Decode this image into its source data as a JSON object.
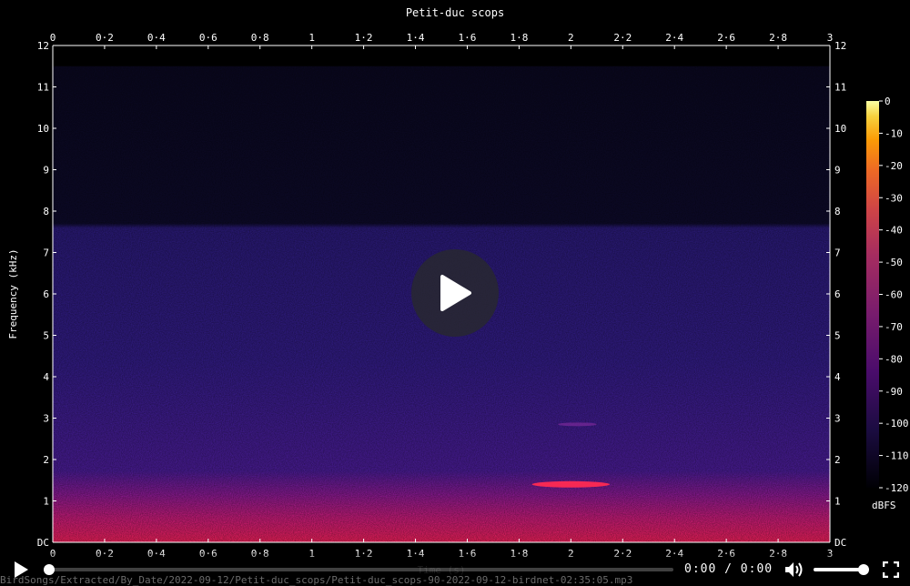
{
  "chart_data": {
    "type": "heatmap",
    "title": "Petit-duc scops",
    "xlabel": "Time (s)",
    "ylabel": "Frequency (kHz)",
    "xlim": [
      0,
      3
    ],
    "ylim": [
      0,
      12
    ],
    "x_ticks": [
      "0",
      "0·2",
      "0·4",
      "0·6",
      "0·8",
      "1",
      "1·2",
      "1·4",
      "1·6",
      "1·8",
      "2",
      "2·2",
      "2·4",
      "2·6",
      "2·8",
      "3"
    ],
    "y_ticks": [
      "DC",
      "1",
      "2",
      "3",
      "4",
      "5",
      "6",
      "7",
      "8",
      "9",
      "10",
      "11",
      "12"
    ],
    "colorbar": {
      "label": "dBFS",
      "ticks": [
        "0",
        "-10",
        "-20",
        "-30",
        "-40",
        "-50",
        "-60",
        "-70",
        "-80",
        "-90",
        "-100",
        "-110",
        "-120"
      ],
      "range": [
        -120,
        0
      ]
    },
    "features": [
      {
        "x_start": 1.85,
        "x_end": 2.15,
        "freq_khz": 1.4,
        "level_dbfs": -45
      },
      {
        "x_start": 1.95,
        "x_end": 2.1,
        "freq_khz": 2.85,
        "level_dbfs": -90
      }
    ]
  },
  "player": {
    "current_time": "0:00",
    "separator": "/",
    "duration": "0:00",
    "file_path": "BirdSongs/Extracted/By_Date/2022-09-12/Petit-duc_scops/Petit-duc_scops-90-2022-09-12-birdnet-02:35:05.mp3",
    "progress": 0,
    "volume": 1.0,
    "icons": {
      "play_overlay": "play-icon",
      "play": "play-icon",
      "volume": "volume-icon",
      "fullscreen": "fullscreen-icon"
    }
  }
}
